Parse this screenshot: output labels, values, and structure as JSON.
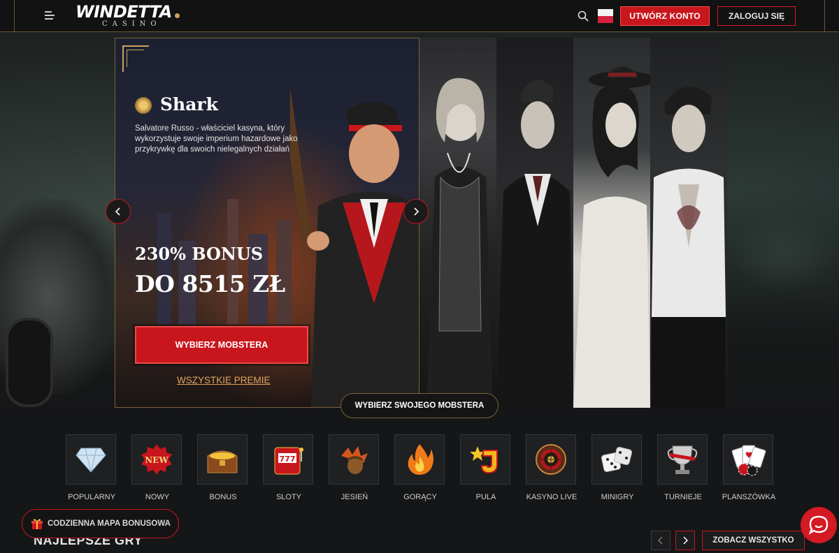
{
  "header": {
    "logo_text": "WINDETTA",
    "logo_sub": "CASINO",
    "register_label": "UTWÓRZ KONTO",
    "login_label": "ZALOGUJ SIĘ"
  },
  "promo": {
    "mobster_name": "Shark",
    "description": "Salvatore Russo - właściciel kasyna, który wykorzystuje swoje imperium hazardowe jako przykrywkę dla swoich nielegalnych działań",
    "bonus_line1": "230% BONUS",
    "bonus_line2": "DO 8515 ZŁ",
    "choose_button": "WYBIERZ MOBSTERA",
    "all_bonuses_link": "WSZYSTKIE PREMIE"
  },
  "carousel": {
    "choose_pill": "WYBIERZ SWOJEGO MOBSTERA"
  },
  "categories": [
    {
      "label": "POPULARNY",
      "icon": "diamond-icon"
    },
    {
      "label": "NOWY",
      "icon": "new-badge-icon"
    },
    {
      "label": "BONUS",
      "icon": "treasure-chest-icon"
    },
    {
      "label": "SLOTY",
      "icon": "slot-machine-icon"
    },
    {
      "label": "JESIEŃ",
      "icon": "autumn-leaves-icon"
    },
    {
      "label": "GORĄCY",
      "icon": "fire-icon"
    },
    {
      "label": "PULA",
      "icon": "jackpot-icon"
    },
    {
      "label": "KASYNO LIVE",
      "icon": "roulette-icon"
    },
    {
      "label": "MINIGRY",
      "icon": "dice-icon"
    },
    {
      "label": "TURNIEJE",
      "icon": "trophy-icon"
    },
    {
      "label": "PLANSZÓWKA",
      "icon": "cards-icon"
    }
  ],
  "bottom": {
    "bonus_map_label": "CODZIENNA MAPA BONUSOWA",
    "section_title": "NAJLEPSZE GRY",
    "see_all_label": "ZOBACZ WSZYSTKO"
  },
  "colors": {
    "accent_red": "#c8161d",
    "gold": "#c9a25a",
    "background": "#151617"
  }
}
